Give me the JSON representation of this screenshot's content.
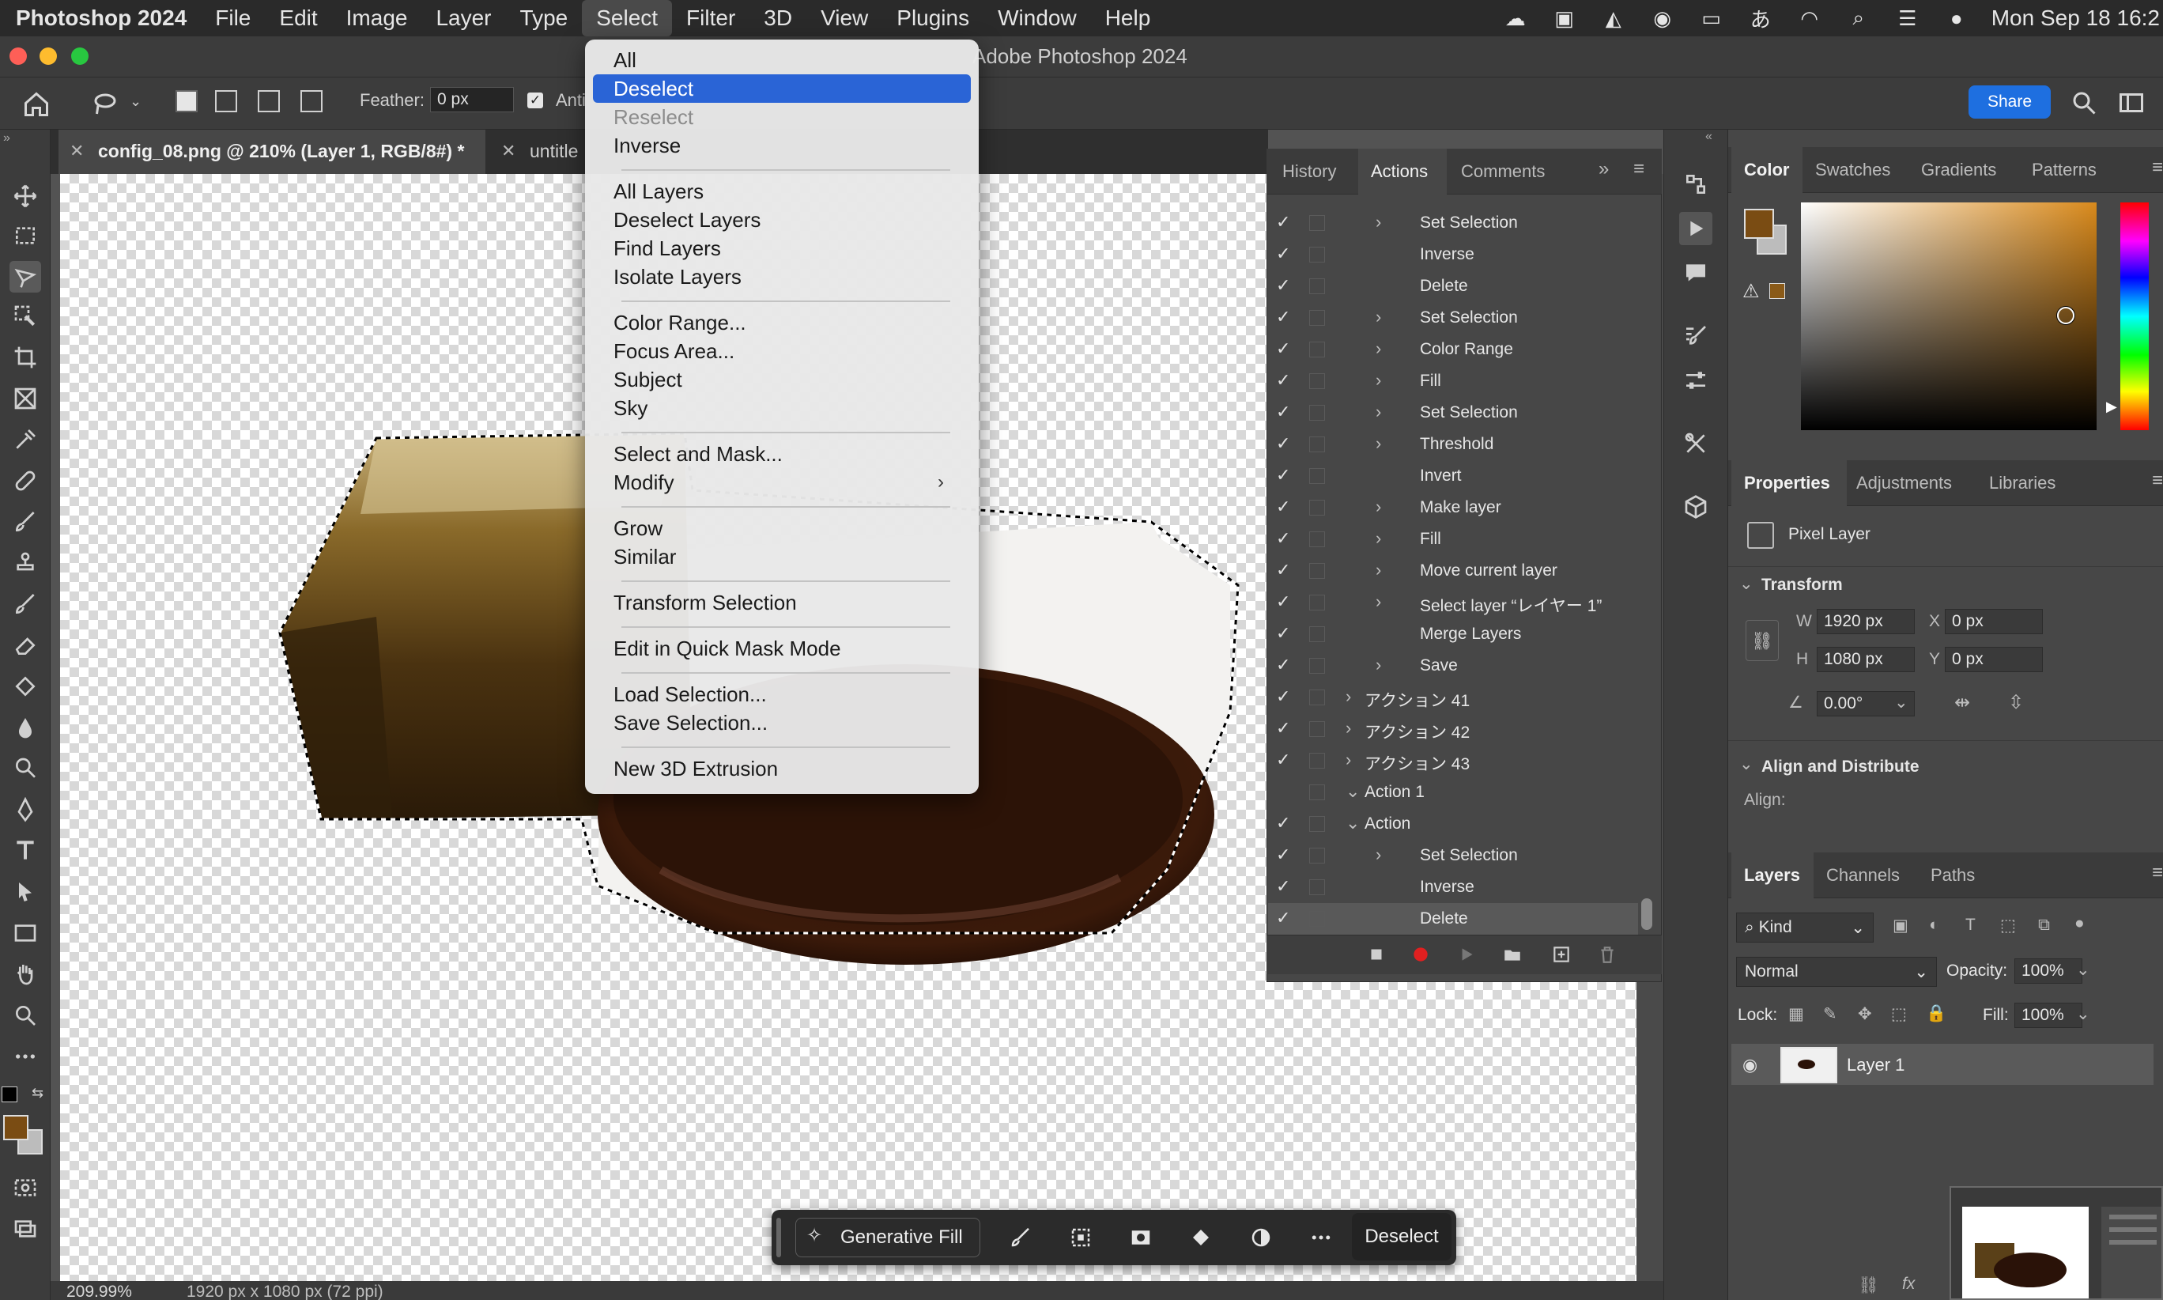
{
  "menubar": {
    "app_name": "Photoshop 2024",
    "items": [
      "File",
      "Edit",
      "Image",
      "Layer",
      "Type",
      "Select",
      "Filter",
      "3D",
      "View",
      "Plugins",
      "Window",
      "Help"
    ],
    "active_item": "Select",
    "clock": "Mon Sep 18  16:2"
  },
  "window": {
    "title": "Adobe Photoshop 2024"
  },
  "options_bar": {
    "feather_label": "Feather:",
    "feather_value": "0 px",
    "antialias_label": "Anti",
    "share_label": "Share"
  },
  "doc_tabs": [
    {
      "label": "config_08.png @ 210% (Layer 1, RGB/8#) *",
      "active": true
    },
    {
      "label": "untitle",
      "active": false
    }
  ],
  "status_bar": {
    "zoom": "209.99%",
    "doc_size": "1920 px x 1080 px (72 ppi)"
  },
  "select_menu": {
    "items": {
      "all": "All",
      "deselect": "Deselect",
      "reselect": "Reselect",
      "inverse": "Inverse",
      "all_layers": "All Layers",
      "deselect_layers": "Deselect Layers",
      "find_layers": "Find Layers",
      "isolate_layers": "Isolate Layers",
      "color_range": "Color Range...",
      "focus_area": "Focus Area...",
      "subject": "Subject",
      "sky": "Sky",
      "select_and_mask": "Select and Mask...",
      "modify": "Modify",
      "grow": "Grow",
      "similar": "Similar",
      "transform_selection": "Transform Selection",
      "quick_mask": "Edit in Quick Mask Mode",
      "load_selection": "Load Selection...",
      "save_selection": "Save Selection...",
      "new_3d_extrusion": "New 3D Extrusion"
    },
    "highlighted": "Deselect",
    "disabled": [
      "Reselect"
    ]
  },
  "actions_panel": {
    "tabs": [
      "History",
      "Actions",
      "Comments"
    ],
    "active_tab": "Actions",
    "rows": [
      {
        "label": "Set Selection",
        "checked": true,
        "expandable": true,
        "indent": 2
      },
      {
        "label": "Inverse",
        "checked": true,
        "expandable": false,
        "indent": 2
      },
      {
        "label": "Delete",
        "checked": true,
        "expandable": false,
        "indent": 2
      },
      {
        "label": "Set Selection",
        "checked": true,
        "expandable": true,
        "indent": 2
      },
      {
        "label": "Color Range",
        "checked": true,
        "expandable": true,
        "indent": 2
      },
      {
        "label": "Fill",
        "checked": true,
        "expandable": true,
        "indent": 2
      },
      {
        "label": "Set Selection",
        "checked": true,
        "expandable": true,
        "indent": 2
      },
      {
        "label": "Threshold",
        "checked": true,
        "expandable": true,
        "indent": 2
      },
      {
        "label": "Invert",
        "checked": true,
        "expandable": false,
        "indent": 2
      },
      {
        "label": "Make layer",
        "checked": true,
        "expandable": true,
        "indent": 2
      },
      {
        "label": "Fill",
        "checked": true,
        "expandable": true,
        "indent": 2
      },
      {
        "label": "Move current layer",
        "checked": true,
        "expandable": true,
        "indent": 2
      },
      {
        "label": "Select layer “レイヤー 1”",
        "checked": true,
        "expandable": true,
        "indent": 2
      },
      {
        "label": "Merge Layers",
        "checked": true,
        "expandable": false,
        "indent": 2
      },
      {
        "label": "Save",
        "checked": true,
        "expandable": true,
        "indent": 2
      },
      {
        "label": "アクション 41",
        "checked": true,
        "expandable": true,
        "indent": 1
      },
      {
        "label": "アクション 42",
        "checked": true,
        "expandable": true,
        "indent": 1
      },
      {
        "label": "アクション 43",
        "checked": true,
        "expandable": true,
        "indent": 1
      },
      {
        "label": "Action 1",
        "checked": false,
        "expandable": true,
        "expanded": true,
        "indent": 1
      },
      {
        "label": "Action",
        "checked": true,
        "expandable": true,
        "expanded": true,
        "indent": 1
      },
      {
        "label": "Set Selection",
        "checked": true,
        "expandable": true,
        "indent": 2
      },
      {
        "label": "Inverse",
        "checked": true,
        "expandable": false,
        "indent": 2
      },
      {
        "label": "Delete",
        "checked": true,
        "expandable": false,
        "indent": 2,
        "selected": true
      }
    ]
  },
  "color_panel": {
    "tabs": [
      "Color",
      "Swatches",
      "Gradients",
      "Patterns"
    ],
    "active_tab": "Color",
    "foreground": "#7a4c13",
    "background": "#bcbcbc"
  },
  "properties_panel": {
    "tabs": [
      "Properties",
      "Adjustments",
      "Libraries"
    ],
    "active_tab": "Properties",
    "layer_type": "Pixel Layer",
    "transform_label": "Transform",
    "w_label": "W",
    "w_value": "1920 px",
    "h_label": "H",
    "h_value": "1080 px",
    "x_label": "X",
    "x_value": "0 px",
    "y_label": "Y",
    "y_value": "0 px",
    "angle_value": "0.00°",
    "align_label": "Align and Distribute",
    "align_sub": "Align:"
  },
  "layers_panel": {
    "tabs": [
      "Layers",
      "Channels",
      "Paths"
    ],
    "active_tab": "Layers",
    "filter": "Kind",
    "blend_mode": "Normal",
    "opacity_label": "Opacity:",
    "opacity_value": "100%",
    "lock_label": "Lock:",
    "fill_label": "Fill:",
    "fill_value": "100%",
    "layer_name": "Layer 1"
  },
  "taskbar": {
    "generative_fill": "Generative Fill",
    "deselect": "Deselect"
  }
}
